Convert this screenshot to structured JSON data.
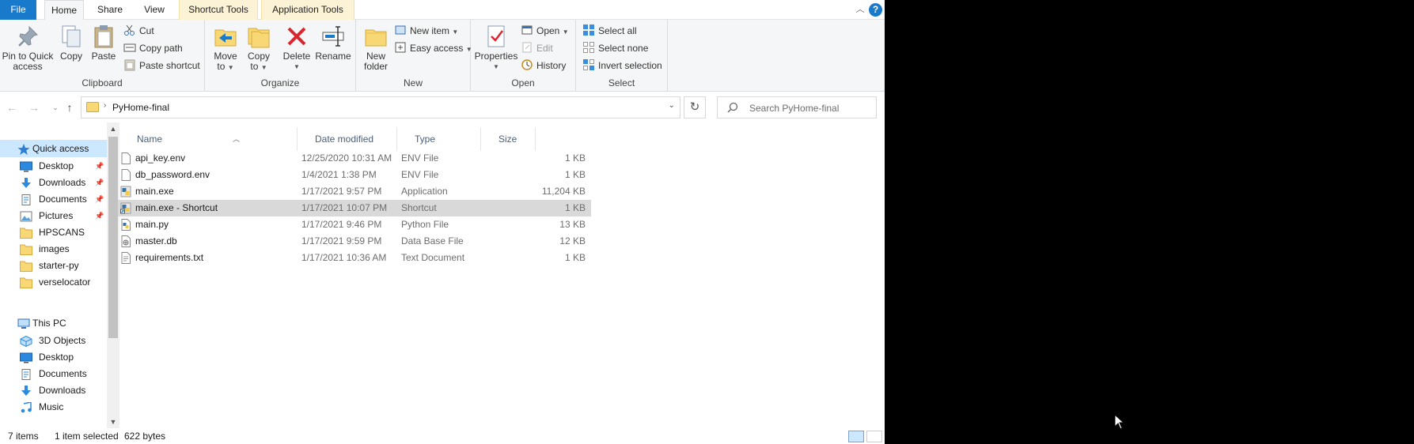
{
  "ribbon_tabs": {
    "file": "File",
    "home": "Home",
    "share": "Share",
    "view": "View",
    "shortcut_tools": "Shortcut Tools",
    "application_tools": "Application Tools"
  },
  "ribbon": {
    "clipboard": {
      "label": "Clipboard",
      "pin_line1": "Pin to Quick",
      "pin_line2": "access",
      "copy": "Copy",
      "paste": "Paste",
      "cut": "Cut",
      "copy_path": "Copy path",
      "paste_shortcut": "Paste shortcut"
    },
    "organize": {
      "label": "Organize",
      "move_line1": "Move",
      "move_line2": "to",
      "copy_line1": "Copy",
      "copy_line2": "to",
      "delete": "Delete",
      "rename": "Rename"
    },
    "new": {
      "label": "New",
      "folder_line1": "New",
      "folder_line2": "folder",
      "new_item": "New item",
      "easy_access": "Easy access"
    },
    "open": {
      "label": "Open",
      "properties": "Properties",
      "open": "Open",
      "edit": "Edit",
      "history": "History"
    },
    "select": {
      "label": "Select",
      "select_all": "Select all",
      "select_none": "Select none",
      "invert_selection": "Invert selection"
    }
  },
  "address": {
    "path": "PyHome-final",
    "search_placeholder": "Search PyHome-final"
  },
  "nav": {
    "quick_access": "Quick access",
    "quick_items": [
      {
        "label": "Desktop",
        "icon": "desktop-icon"
      },
      {
        "label": "Downloads",
        "icon": "downloads-icon"
      },
      {
        "label": "Documents",
        "icon": "documents-icon"
      },
      {
        "label": "Pictures",
        "icon": "pictures-icon"
      },
      {
        "label": "HPSCANS",
        "icon": "folder-icon"
      },
      {
        "label": "images",
        "icon": "folder-icon"
      },
      {
        "label": "starter-py",
        "icon": "folder-icon"
      },
      {
        "label": "verselocator",
        "icon": "folder-icon"
      }
    ],
    "this_pc": "This PC",
    "pc_items": [
      {
        "label": "3D Objects",
        "icon": "3d-objects-icon"
      },
      {
        "label": "Desktop",
        "icon": "desktop-icon"
      },
      {
        "label": "Documents",
        "icon": "documents-icon"
      },
      {
        "label": "Downloads",
        "icon": "downloads-icon"
      },
      {
        "label": "Music",
        "icon": "music-icon"
      }
    ]
  },
  "columns": {
    "name": "Name",
    "date": "Date modified",
    "type": "Type",
    "size": "Size"
  },
  "files": [
    {
      "name": "api_key.env",
      "date": "12/25/2020 10:31 AM",
      "type": "ENV File",
      "size": "1 KB",
      "icon": "generic-file-icon"
    },
    {
      "name": "db_password.env",
      "date": "1/4/2021 1:38 PM",
      "type": "ENV File",
      "size": "1 KB",
      "icon": "generic-file-icon"
    },
    {
      "name": "main.exe",
      "date": "1/17/2021 9:57 PM",
      "type": "Application",
      "size": "11,204 KB",
      "icon": "python-app-icon"
    },
    {
      "name": "main.exe - Shortcut",
      "date": "1/17/2021 10:07 PM",
      "type": "Shortcut",
      "size": "1 KB",
      "icon": "shortcut-icon"
    },
    {
      "name": "main.py",
      "date": "1/17/2021 9:46 PM",
      "type": "Python File",
      "size": "13 KB",
      "icon": "python-file-icon"
    },
    {
      "name": "master.db",
      "date": "1/17/2021 9:59 PM",
      "type": "Data Base File",
      "size": "12 KB",
      "icon": "database-file-icon"
    },
    {
      "name": "requirements.txt",
      "date": "1/17/2021 10:36 AM",
      "type": "Text Document",
      "size": "1 KB",
      "icon": "text-file-icon"
    }
  ],
  "status": {
    "items": "7 items",
    "selected": "1 item selected",
    "size": "622 bytes"
  },
  "colors": {
    "accent": "#1979ca",
    "selection": "#d9d9d9",
    "nav_selection": "#cce8ff",
    "contextual_tab": "#fcf3d7"
  }
}
